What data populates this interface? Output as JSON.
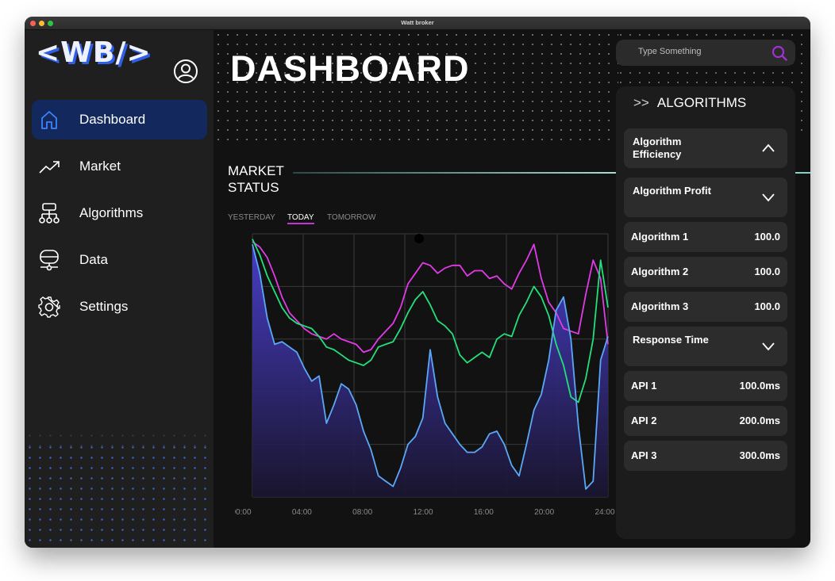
{
  "window": {
    "title": "Watt broker"
  },
  "colors": {
    "accent_blue": "#2f5fe8",
    "nav_active": "#13295e",
    "series_magenta": "#e23ae6",
    "series_green": "#22e07a",
    "series_blue": "#5aa8f5",
    "tab_underline": "#c532d8"
  },
  "sidebar": {
    "logo": "<WB/>",
    "profile_icon": "user-circle-icon",
    "items": [
      {
        "label": "Dashboard",
        "icon": "home-icon",
        "active": true
      },
      {
        "label": "Market",
        "icon": "trend-icon",
        "active": false
      },
      {
        "label": "Algorithms",
        "icon": "hierarchy-icon",
        "active": false
      },
      {
        "label": "Data",
        "icon": "database-icon",
        "active": false
      },
      {
        "label": "Settings",
        "icon": "gear-icon",
        "active": false
      }
    ]
  },
  "header": {
    "title": "DASHBOARD"
  },
  "search": {
    "placeholder": "Type Something",
    "icon": "search-icon"
  },
  "market": {
    "title": "MARKET STATUS",
    "tabs": [
      {
        "label": "YESTERDAY",
        "active": false
      },
      {
        "label": "TODAY",
        "active": true
      },
      {
        "label": "TOMORROW",
        "active": false
      }
    ]
  },
  "chart_data": {
    "type": "line",
    "x_tick_labels": [
      "00:00",
      "04:00",
      "08:00",
      "12:00",
      "16:00",
      "20:00",
      "24:00"
    ],
    "xlim": [
      0,
      24
    ],
    "ylim": [
      0,
      100
    ],
    "grid": true,
    "x": [
      0,
      0.5,
      1,
      1.5,
      2,
      2.5,
      3,
      3.5,
      4,
      4.5,
      5,
      5.5,
      6,
      6.5,
      7,
      7.5,
      8,
      8.5,
      9,
      9.5,
      10,
      10.5,
      11,
      11.5,
      12,
      12.5,
      13,
      13.5,
      14,
      14.5,
      15,
      15.5,
      16,
      16.5,
      17,
      17.5,
      18,
      18.5,
      19,
      19.5,
      20,
      20.5,
      21,
      21.5,
      22,
      22.5,
      23,
      23.5,
      24
    ],
    "series": [
      {
        "color": "#e23ae6",
        "values": [
          97,
          95,
          91,
          84,
          76,
          70,
          67,
          64,
          62,
          61,
          60,
          62,
          60,
          59,
          58,
          55,
          56,
          60,
          63,
          66,
          72,
          81,
          85,
          89,
          88,
          85,
          87,
          88,
          88,
          84,
          86,
          86,
          83,
          84,
          81,
          79,
          85,
          90,
          96,
          83,
          74,
          70,
          64,
          63,
          62,
          77,
          90,
          83,
          58
        ]
      },
      {
        "color": "#22e07a",
        "values": [
          98,
          92,
          84,
          78,
          72,
          68,
          66,
          65,
          64,
          61,
          57,
          56,
          54,
          52,
          51,
          50,
          52,
          57,
          58,
          59,
          64,
          70,
          75,
          78,
          73,
          67,
          65,
          62,
          54,
          51,
          53,
          55,
          53,
          60,
          62,
          61,
          69,
          74,
          80,
          76,
          69,
          58,
          50,
          38,
          36,
          45,
          60,
          90,
          72
        ]
      },
      {
        "color": "#5aa8f5",
        "values": [
          96,
          85,
          68,
          58,
          59,
          57,
          55,
          49,
          44,
          46,
          28,
          35,
          43,
          41,
          35,
          25,
          18,
          8,
          6,
          4,
          11,
          20,
          23,
          30,
          56,
          38,
          28,
          24,
          20,
          17,
          17,
          19,
          24,
          25,
          20,
          12,
          8,
          20,
          33,
          39,
          52,
          71,
          76,
          60,
          27,
          3,
          6,
          52,
          61
        ]
      }
    ]
  },
  "algorithms": {
    "header": "ALGORITHMS",
    "sections": [
      {
        "label": "Algorithm Efficiency",
        "state": "expanded",
        "icon": "chevron-up-icon"
      },
      {
        "label": "Algorithm Profit",
        "state": "collapsed",
        "icon": "chevron-down-icon"
      },
      {
        "label": "Response Time",
        "state": "collapsed",
        "icon": "chevron-down-icon"
      }
    ],
    "rows": [
      {
        "label": "Algorithm 1",
        "value": "100.0"
      },
      {
        "label": "Algorithm 2",
        "value": "100.0"
      },
      {
        "label": "Algorithm 3",
        "value": "100.0"
      },
      {
        "label": "API 1",
        "value": "100.0ms"
      },
      {
        "label": "API 2",
        "value": "200.0ms"
      },
      {
        "label": "API 3",
        "value": "300.0ms"
      }
    ]
  }
}
